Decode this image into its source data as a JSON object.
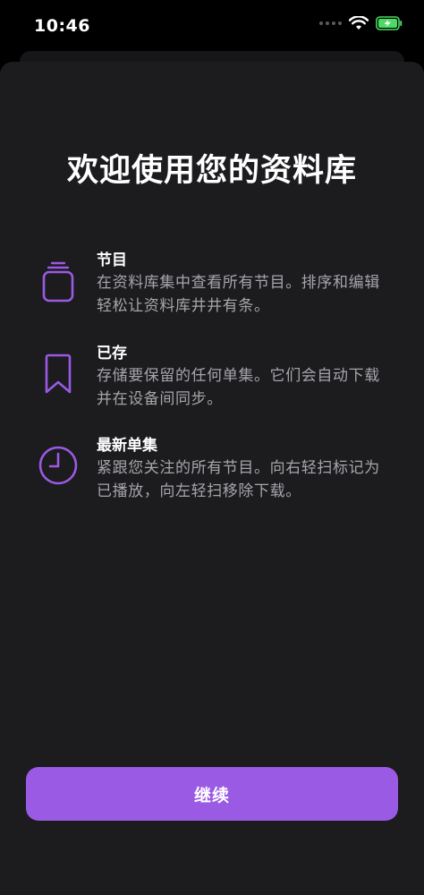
{
  "status_bar": {
    "time": "10:46"
  },
  "title": "欢迎使用您的资料库",
  "features": [
    {
      "icon": "library-stack-icon",
      "title": "节目",
      "description": "在资料库集中查看所有节目。排序和编辑轻松让资料库井井有条。"
    },
    {
      "icon": "bookmark-icon",
      "title": "已存",
      "description": "存储要保留的任何单集。它们会自动下载并在设备间同步。"
    },
    {
      "icon": "clock-icon",
      "title": "最新单集",
      "description": "紧跟您关注的所有节目。向右轻扫标记为已播放，向左轻扫移除下载。"
    }
  ],
  "continue_label": "继续",
  "colors": {
    "accent": "#9a5ae4",
    "sheet_background": "#1c1b1e",
    "description_text": "#a6a5aa",
    "battery_green": "#4cd964"
  }
}
